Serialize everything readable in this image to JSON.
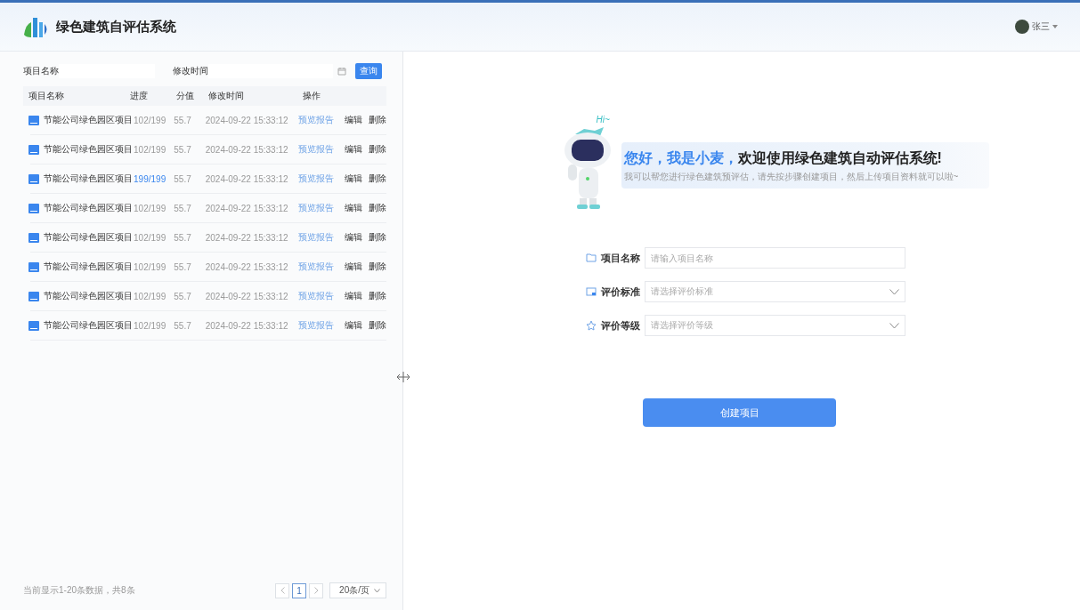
{
  "header": {
    "title": "绿色建筑自评估系统",
    "user": "张三"
  },
  "filter": {
    "name_label": "项目名称",
    "time_label": "修改时间",
    "search_button": "查询"
  },
  "table": {
    "columns": [
      "项目名称",
      "进度",
      "分值",
      "修改时间",
      "操作"
    ],
    "rows": [
      {
        "name": "节能公司绿色园区项目",
        "progress": "102/199",
        "complete": false,
        "score": "55.7",
        "time": "2024-09-22 15:33:12",
        "actions": [
          "预览报告",
          "编辑",
          "删除"
        ]
      },
      {
        "name": "节能公司绿色园区项目",
        "progress": "102/199",
        "complete": false,
        "score": "55.7",
        "time": "2024-09-22 15:33:12",
        "actions": [
          "预览报告",
          "编辑",
          "删除"
        ]
      },
      {
        "name": "节能公司绿色园区项目",
        "progress": "199/199",
        "complete": true,
        "score": "55.7",
        "time": "2024-09-22 15:33:12",
        "actions": [
          "预览报告",
          "编辑",
          "删除"
        ]
      },
      {
        "name": "节能公司绿色园区项目",
        "progress": "102/199",
        "complete": false,
        "score": "55.7",
        "time": "2024-09-22 15:33:12",
        "actions": [
          "预览报告",
          "编辑",
          "删除"
        ]
      },
      {
        "name": "节能公司绿色园区项目",
        "progress": "102/199",
        "complete": false,
        "score": "55.7",
        "time": "2024-09-22 15:33:12",
        "actions": [
          "预览报告",
          "编辑",
          "删除"
        ]
      },
      {
        "name": "节能公司绿色园区项目",
        "progress": "102/199",
        "complete": false,
        "score": "55.7",
        "time": "2024-09-22 15:33:12",
        "actions": [
          "预览报告",
          "编辑",
          "删除"
        ]
      },
      {
        "name": "节能公司绿色园区项目",
        "progress": "102/199",
        "complete": false,
        "score": "55.7",
        "time": "2024-09-22 15:33:12",
        "actions": [
          "预览报告",
          "编辑",
          "删除"
        ]
      },
      {
        "name": "节能公司绿色园区项目",
        "progress": "102/199",
        "complete": false,
        "score": "55.7",
        "time": "2024-09-22 15:33:12",
        "actions": [
          "预览报告",
          "编辑",
          "删除"
        ]
      }
    ]
  },
  "pagination": {
    "summary": "当前显示1-20条数据，共8条",
    "pages": [
      {
        "label": "1",
        "selected": true
      }
    ],
    "page_size": "20条/页"
  },
  "welcome": {
    "hi": "Hi~",
    "greeting_highlight": "您好，我是小麦，",
    "greeting": "欢迎使用绿色建筑自动评估系统!",
    "subtitle": "我可以帮您进行绿色建筑预评估，请先按步骤创建项目，然后上传项目资料就可以啦~"
  },
  "form": {
    "fields": [
      {
        "kind": "input",
        "label": "项目名称",
        "placeholder": "请输入项目名称"
      },
      {
        "kind": "select",
        "label": "评价标准",
        "placeholder": "请选择评价标准"
      },
      {
        "kind": "select",
        "label": "评价等级",
        "placeholder": "请选择评价等级"
      }
    ],
    "submit": "创建项目"
  }
}
